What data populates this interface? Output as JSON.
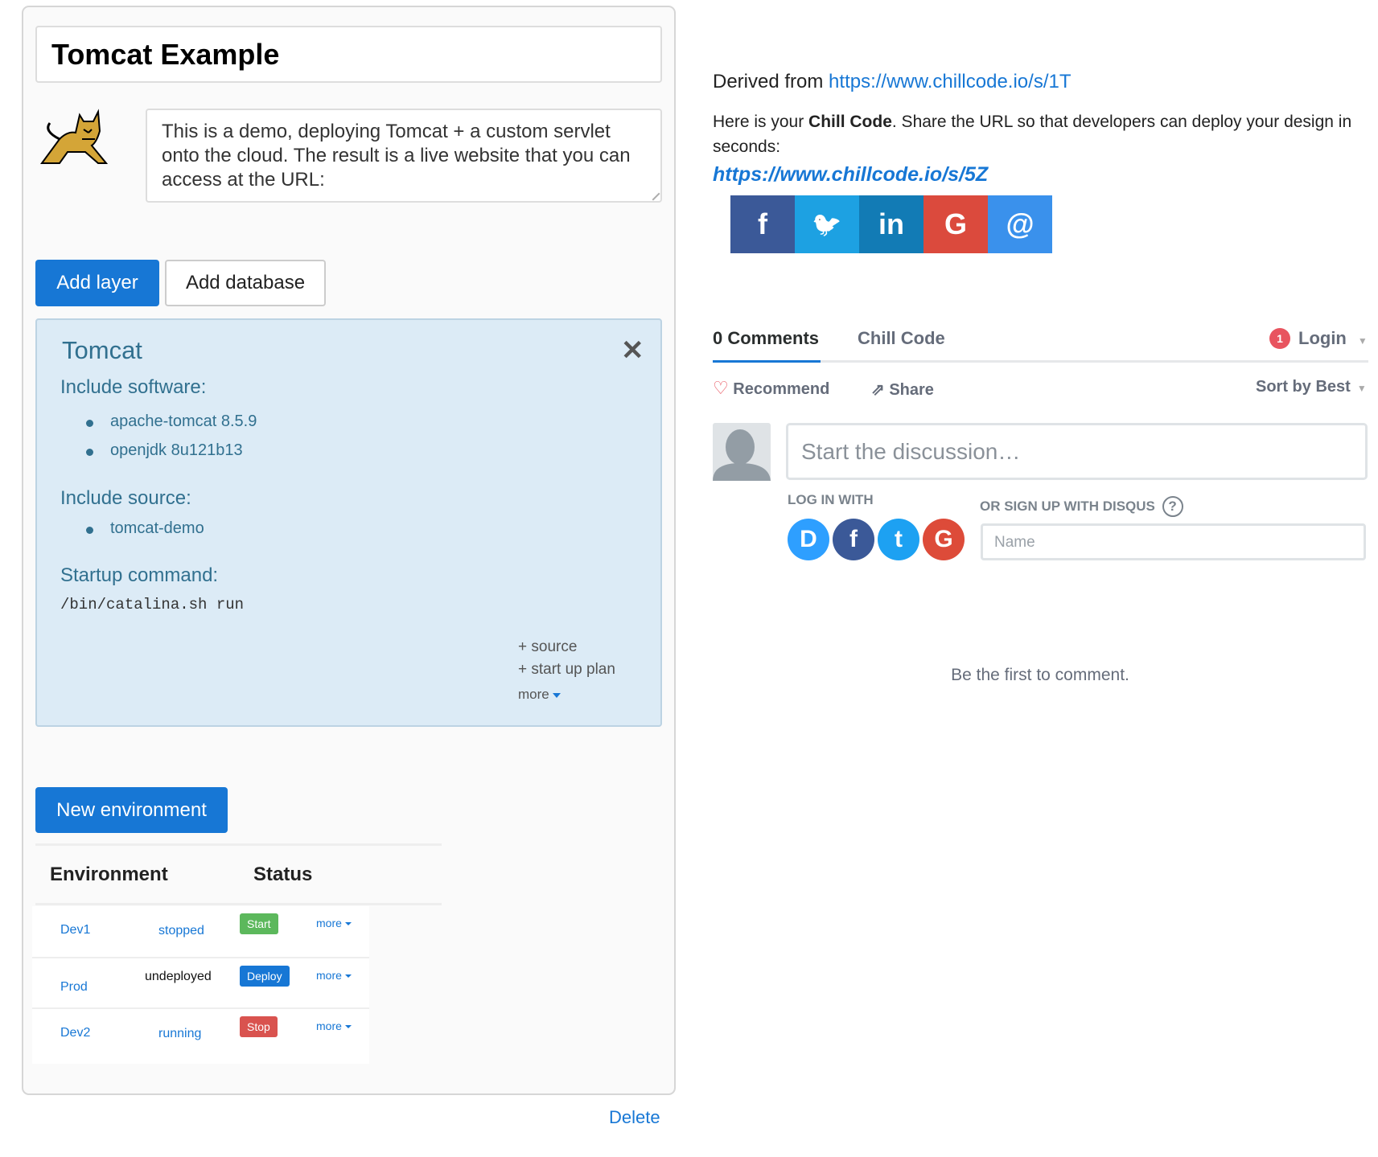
{
  "project": {
    "title": "Tomcat Example",
    "description": "This is a demo, deploying Tomcat + a custom servlet onto the cloud. The result is a live website that you can access at the URL:"
  },
  "toolbar": {
    "add_layer": "Add layer",
    "add_database": "Add database"
  },
  "layer": {
    "name": "Tomcat",
    "software_label": "Include software:",
    "software": [
      "apache-tomcat 8.5.9",
      "openjdk 8u121b13"
    ],
    "source_label": "Include source:",
    "sources": [
      "tomcat-demo"
    ],
    "startup_label": "Startup command:",
    "startup_command": "/bin/catalina.sh run",
    "add_source": "+ source",
    "add_plan": "+ start up plan",
    "more": "more"
  },
  "environments": {
    "new_button": "New environment",
    "headers": [
      "Environment",
      "Status"
    ],
    "rows": [
      {
        "name": "Dev1",
        "status": "stopped",
        "action": "Start",
        "action_color": "#5cb85c",
        "more": "more"
      },
      {
        "name": "Prod",
        "status": "undeployed",
        "action": "Deploy",
        "action_color": "#1777d5",
        "more": "more"
      },
      {
        "name": "Dev2",
        "status": "running",
        "action": "Stop",
        "action_color": "#d9534f",
        "more": "more"
      }
    ]
  },
  "delete_label": "Delete",
  "right": {
    "derived_prefix": "Derived from ",
    "derived_url": "https://www.chillcode.io/s/1T",
    "info_pre": "Here is your ",
    "info_bold": "Chill Code",
    "info_post": ". Share the URL so that developers can deploy your design in seconds:",
    "share_url": "https://www.chillcode.io/s/5Z",
    "share_buttons": [
      {
        "icon": "facebook-icon",
        "glyph": "f",
        "color": "#3b5998"
      },
      {
        "icon": "twitter-icon",
        "glyph": "🐦",
        "color": "#1da1e2"
      },
      {
        "icon": "linkedin-icon",
        "glyph": "in",
        "color": "#127bb5"
      },
      {
        "icon": "google-icon",
        "glyph": "G",
        "color": "#db4a3d"
      },
      {
        "icon": "email-icon",
        "glyph": "@",
        "color": "#3a91ec"
      }
    ]
  },
  "comments": {
    "tab_comments": "0 Comments",
    "tab_site": "Chill Code",
    "badge": "1",
    "login": "Login",
    "recommend": "Recommend",
    "share": "Share",
    "sort": "Sort by Best",
    "placeholder": "Start the discussion…",
    "login_with": "LOG IN WITH",
    "signup": "OR SIGN UP WITH DISQUS",
    "help": "?",
    "name_placeholder": "Name",
    "empty": "Be the first to comment.",
    "login_icons": [
      {
        "icon": "disqus-icon",
        "glyph": "D",
        "color": "#2e9fff"
      },
      {
        "icon": "facebook-icon",
        "glyph": "f",
        "color": "#3b5998"
      },
      {
        "icon": "twitter-icon",
        "glyph": "t",
        "color": "#1da1f2"
      },
      {
        "icon": "google-icon",
        "glyph": "G",
        "color": "#dd4b39"
      }
    ]
  }
}
